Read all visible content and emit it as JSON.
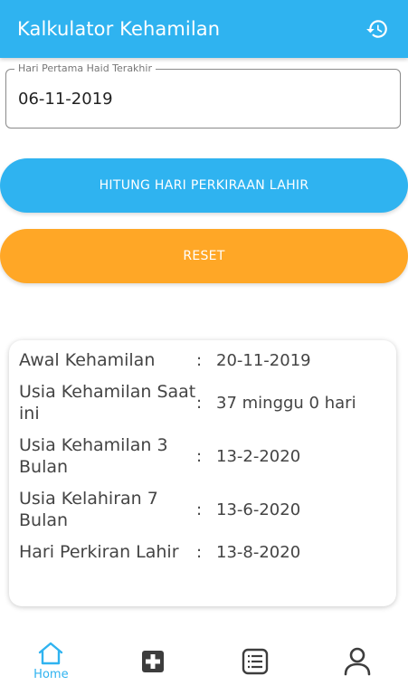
{
  "appbar": {
    "title": "Kalkulator Kehamilan",
    "history_icon": "history-icon",
    "background": "#2fb3f0"
  },
  "form": {
    "label": "Hari Pertama Haid Terakhir",
    "value": "06-11-2019"
  },
  "buttons": {
    "hitung_label": "HITUNG HARI PERKIRAAN LAHIR",
    "hitung_color": "#2fb3f0",
    "reset_label": "RESET",
    "reset_color": "#ffa726"
  },
  "results": [
    {
      "label": "Awal Kehamilan",
      "colon": ":",
      "value": "20-11-2019"
    },
    {
      "label": "Usia Kehamilan Saat ini",
      "colon": ":",
      "value": "37 minggu 0 hari"
    },
    {
      "label": "Usia Kehamilan 3 Bulan",
      "colon": ":",
      "value": "13-2-2020"
    },
    {
      "label": "Usia Kelahiran 7 Bulan",
      "colon": ":",
      "value": "13-6-2020"
    },
    {
      "label": "Hari Perkiran Lahir",
      "colon": ":",
      "value": "13-8-2020"
    }
  ],
  "nav": {
    "home_label": "Home",
    "items": [
      "home-icon",
      "medical-plus-icon",
      "list-icon",
      "person-icon"
    ],
    "active_color": "#2fb3f0"
  }
}
